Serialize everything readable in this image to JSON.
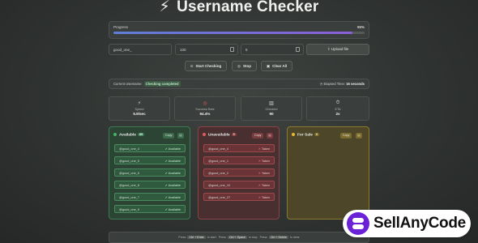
{
  "app": {
    "title": "Username Checker"
  },
  "progress": {
    "label": "Progress",
    "percent_text": "95%",
    "value": 0.95
  },
  "inputs": {
    "username_value": "good_one_",
    "count_value": "100",
    "delay_value": "5",
    "upload_label": "Upload file"
  },
  "actions": {
    "start_label": "Start Checking",
    "stop_label": "Stop",
    "clear_label": "Clear All"
  },
  "status": {
    "current_label": "Current Username:",
    "current_value": "Checking completed",
    "elapsed_label": "Elapsed Time:",
    "elapsed_value": "16 seconds"
  },
  "stats": [
    {
      "icon": "lightning-icon",
      "label": "Speed",
      "value": "5.9/sec"
    },
    {
      "icon": "target-icon",
      "label": "Success Rate",
      "value": "94.4%"
    },
    {
      "icon": "bar-chart-icon",
      "label": "Checked",
      "value": "90"
    },
    {
      "icon": "stopwatch-icon",
      "label": "ETA",
      "value": "2s"
    }
  ],
  "columns": {
    "available": {
      "title": "Available",
      "count": "85",
      "copy_label": "Copy",
      "rows": [
        {
          "name": "@good_one_4",
          "status": "Available"
        },
        {
          "name": "@good_one_5",
          "status": "Available"
        },
        {
          "name": "@good_one_6",
          "status": "Available"
        },
        {
          "name": "@good_one_8",
          "status": "Available"
        },
        {
          "name": "@good_one_7",
          "status": "Available"
        },
        {
          "name": "@good_one_9",
          "status": "Available"
        }
      ]
    },
    "unavailable": {
      "title": "Unavailable",
      "count": "5",
      "copy_label": "Copy",
      "rows": [
        {
          "name": "@good_one_4",
          "status": "Taken"
        },
        {
          "name": "@good_one_1",
          "status": "Taken"
        },
        {
          "name": "@good_one_2",
          "status": "Taken"
        },
        {
          "name": "@good_one_10",
          "status": "Taken"
        },
        {
          "name": "@good_one_27",
          "status": "Taken"
        }
      ]
    },
    "forsale": {
      "title": "For Sale",
      "count": "0",
      "copy_label": "Copy"
    }
  },
  "footer": {
    "press1": "Press",
    "key1": "Ctrl + Enter",
    "after1": "to start",
    "press2": "Press",
    "key2": "Ctrl + Space",
    "after2": "to stop",
    "press3": "Press",
    "key3": "Ctrl + Delete",
    "after3": "to clear"
  },
  "watermark": {
    "text": "SellAnyCode"
  },
  "colors": {
    "available": "#4caf6a",
    "unavailable": "#e05c5c",
    "forsale": "#e2b93b",
    "progress_start": "#5f7fd8",
    "progress_end": "#8b5fd8"
  }
}
